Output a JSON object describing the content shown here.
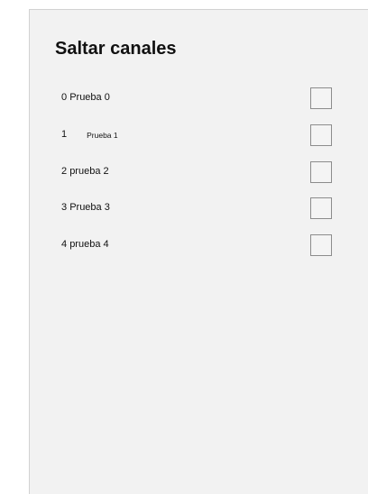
{
  "title": "Saltar canales",
  "channels": [
    {
      "number": "0",
      "name": "Prueba 0",
      "checked": false
    },
    {
      "number": "1",
      "name": "Prueba 1",
      "checked": false
    },
    {
      "number": "2",
      "name": "prueba 2",
      "checked": false
    },
    {
      "number": "3",
      "name": "Prueba 3",
      "checked": false
    },
    {
      "number": "4",
      "name": "prueba 4",
      "checked": false
    }
  ]
}
